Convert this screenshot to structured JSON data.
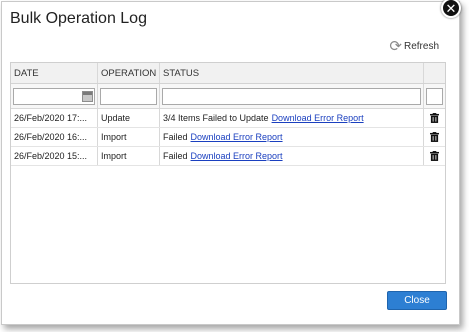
{
  "dialog": {
    "title": "Bulk Operation Log",
    "refresh_label": "Refresh",
    "close_button_label": "Close",
    "close_x_glyph": "✕"
  },
  "grid": {
    "columns": [
      "DATE",
      "OPERATION",
      "STATUS",
      ""
    ],
    "filters": {
      "date": "",
      "operation": "",
      "status": ""
    },
    "rows": [
      {
        "date": "26/Feb/2020 17:...",
        "operation": "Update",
        "status": "3/4 Items Failed to Update",
        "link": "Download Error Report"
      },
      {
        "date": "26/Feb/2020 16:...",
        "operation": "Import",
        "status": "Failed",
        "link": "Download Error Report"
      },
      {
        "date": "26/Feb/2020 15:...",
        "operation": "Import",
        "status": "Failed",
        "link": "Download Error Report"
      }
    ]
  },
  "colors": {
    "accent": "#2d7fd3",
    "link": "#1a3fbf"
  },
  "icons": {
    "refresh": "refresh-icon",
    "delete": "trash-icon",
    "calendar": "calendar-icon",
    "close": "close-icon"
  }
}
